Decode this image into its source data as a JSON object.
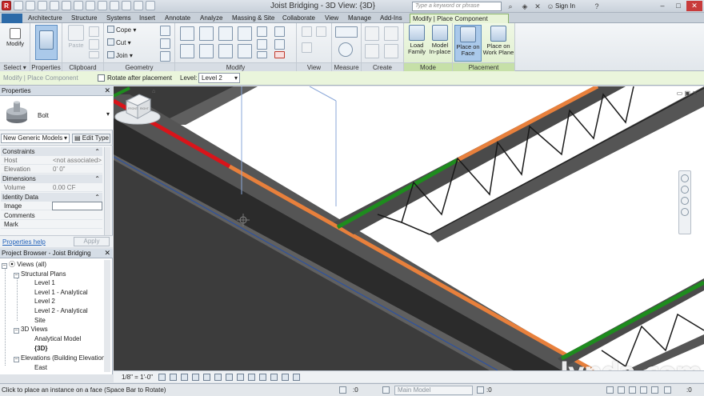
{
  "window": {
    "title": "Joist Bridging - 3D View: {3D}",
    "search_placeholder": "Type a keyword or phrase",
    "sign_in": "Sign In"
  },
  "tabs": [
    "Architecture",
    "Structure",
    "Systems",
    "Insert",
    "Annotate",
    "Analyze",
    "Massing & Site",
    "Collaborate",
    "View",
    "Manage",
    "Add-Ins",
    "Modify | Place Component"
  ],
  "ribbon": {
    "select": {
      "modify": "Modify",
      "label": "Select ▾"
    },
    "properties": {
      "label": "Properties"
    },
    "clipboard": {
      "paste": "Paste",
      "label": "Clipboard"
    },
    "geometry": {
      "cope": "Cope",
      "cut": "Cut",
      "join": "Join",
      "label": "Geometry"
    },
    "modify": {
      "label": "Modify"
    },
    "view": {
      "label": "View"
    },
    "measure": {
      "label": "Measure"
    },
    "create": {
      "label": "Create"
    },
    "mode": {
      "load_family_1": "Load",
      "load_family_2": "Family",
      "model_inplace_1": "Model",
      "model_inplace_2": "In-place",
      "label": "Mode"
    },
    "placement": {
      "face_1": "Place on",
      "face_2": "Face",
      "plane_1": "Place on",
      "plane_2": "Work Plane",
      "label": "Placement"
    }
  },
  "options_bar": {
    "breadcrumb": "Modify | Place Component",
    "rotate_label": "Rotate after placement",
    "level_label": "Level:",
    "level_value": "Level 2"
  },
  "properties": {
    "title": "Properties",
    "type_name": "Bolt",
    "filter": "New Generic Models",
    "edit_type": "Edit Type",
    "groups": {
      "constraints": "Constraints",
      "dimensions": "Dimensions",
      "identity": "Identity Data"
    },
    "rows": {
      "host_k": "Host",
      "host_v": "<not associated>",
      "elev_k": "Elevation",
      "elev_v": "0'  0\"",
      "vol_k": "Volume",
      "vol_v": "0.00 CF",
      "image_k": "Image",
      "comments_k": "Comments",
      "mark_k": "Mark"
    },
    "help": "Properties help",
    "apply": "Apply"
  },
  "browser": {
    "title": "Project Browser - Joist Bridging",
    "views_all": "Views (all)",
    "structural_plans": "Structural Plans",
    "level1": "Level 1",
    "level1_an": "Level 1 - Analytical",
    "level2": "Level 2",
    "level2_an": "Level 2 - Analytical",
    "site": "Site",
    "views_3d": "3D Views",
    "analytical_model": "Analytical Model",
    "view_3d": "{3D}",
    "elevations": "Elevations (Building Elevation",
    "east": "East"
  },
  "view_control": {
    "scale": "1/8\" = 1'-0\""
  },
  "status": {
    "message": "Click to place an instance on a face (Space Bar to Rotate)",
    "zero_a": ":0",
    "workset": "Main Model",
    "zero_b": ":0",
    "filter_count": ":0"
  },
  "watermark": "lynda.com",
  "viewcube": {
    "left_face": "FRONT",
    "right_face": "RIGHT"
  },
  "colors": {
    "accent_green": "#e8f4d8",
    "beam_red": "#d9141a",
    "beam_orange": "#e8803c",
    "beam_green": "#1e8c1e",
    "beam_dark": "#2b2b2b"
  }
}
